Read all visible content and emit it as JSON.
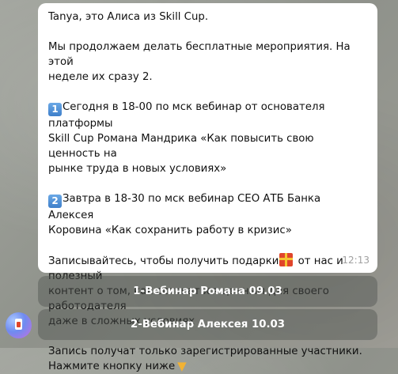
{
  "message": {
    "greeting": "Tanya, это Алиса из Skill Cup.",
    "intro": "Мы продолжаем делать бесплатные мероприятия. На этой\nнеделе их сразу 2.",
    "item1_badge": "1",
    "item1_text": "Сегодня в 18-00 по мск вебинар от основателя платформы\nSkill Cup Романа Мандрика «Как повысить свою ценность на\nрынке труда в новых условиях»",
    "item2_badge": "2",
    "item2_text": "Завтра в 18-30 по мск вебинар CEO АТБ Банка Алексея\nКоровина «Как сохранить работу в кризис»",
    "signup_before_gift": "Записывайтесь, чтобы получить подарки",
    "signup_after_gift": " от нас и полезный\nконтент о том, как оставаться ценным для своего работодателя\nдаже в сложных условиях",
    "notice": "Запись получат только зарегистрированные участники.\nНажмите кнопку ниже",
    "time": "12:13",
    "icons": [
      "keycap-1-icon",
      "keycap-2-icon",
      "gift-icon",
      "pointing-down-icon"
    ]
  },
  "keyboard": {
    "buttons": [
      {
        "label": "1-Вебинар Романа 09.03"
      },
      {
        "label": "2-Вебинар Алексея 10.03"
      }
    ]
  },
  "sender": {
    "avatar": "bot-avatar-icon"
  },
  "colors": {
    "bubble": "#ffffff",
    "button_bg": "#5a5f58",
    "timestamp": "#a0a0a0",
    "keycap": "#4a8ad6",
    "gift": "#e0452b"
  }
}
